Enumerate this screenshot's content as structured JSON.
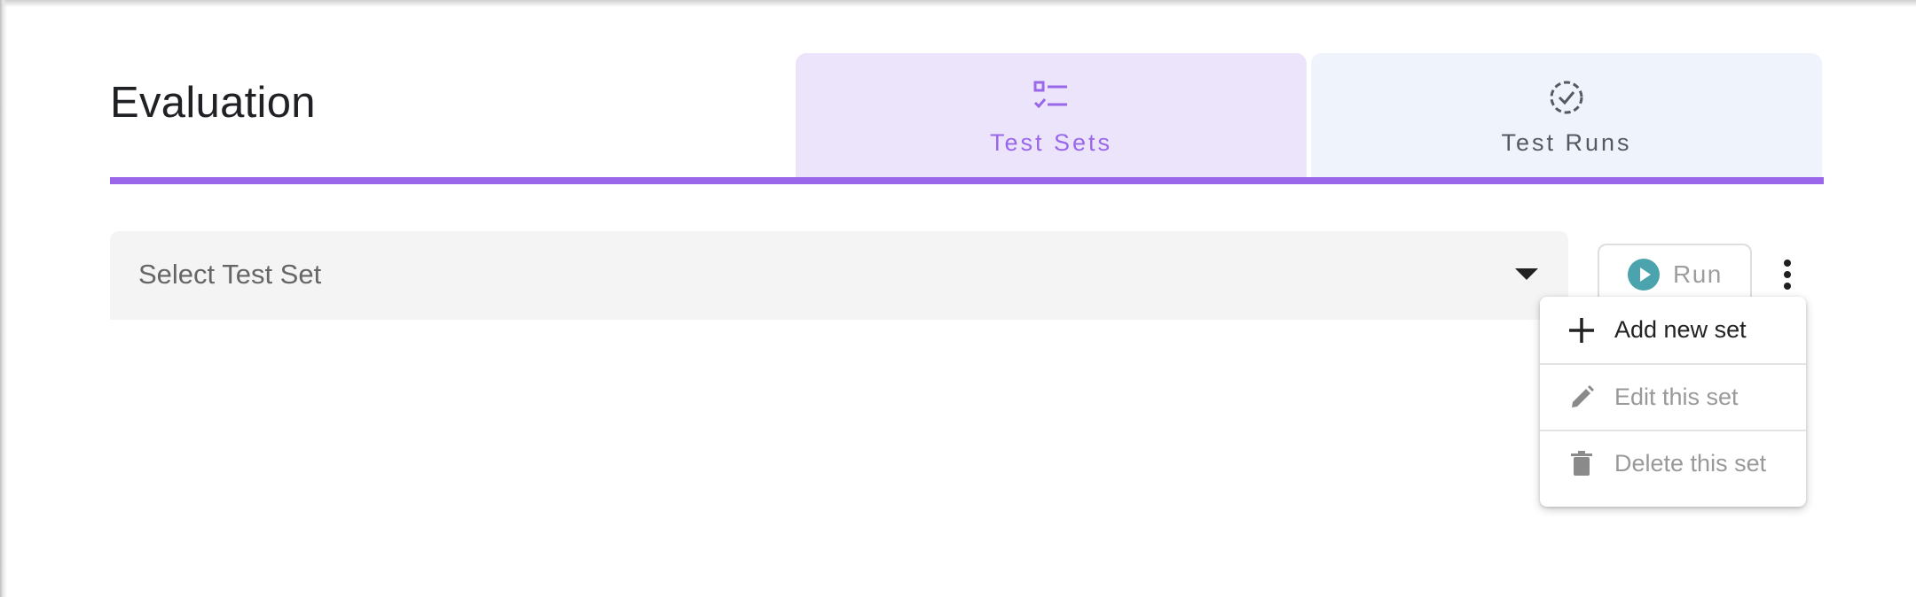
{
  "page": {
    "title": "Evaluation"
  },
  "tabs": [
    {
      "label": "Test Sets",
      "icon": "checklist-icon",
      "active": true
    },
    {
      "label": "Test Runs",
      "icon": "dashed-circle-check-icon",
      "active": false
    }
  ],
  "select": {
    "placeholder": "Select Test Set",
    "icon": "dropdown-arrow-icon"
  },
  "run_button": {
    "label": "Run",
    "icon": "play-circle-icon",
    "enabled": false
  },
  "more_menu": {
    "icon": "more-vert-icon",
    "items": [
      {
        "label": "Add new set",
        "icon": "plus-icon",
        "enabled": true
      },
      {
        "label": "Edit this set",
        "icon": "pencil-icon",
        "enabled": false
      },
      {
        "label": "Delete this set",
        "icon": "trash-icon",
        "enabled": false
      }
    ]
  },
  "colors": {
    "accent": "#9b67ea",
    "active_tab_bg": "#ece4fb",
    "inactive_tab_bg": "#eef3fc",
    "run_icon": "#4ba3ad",
    "disabled_text": "#999999"
  }
}
